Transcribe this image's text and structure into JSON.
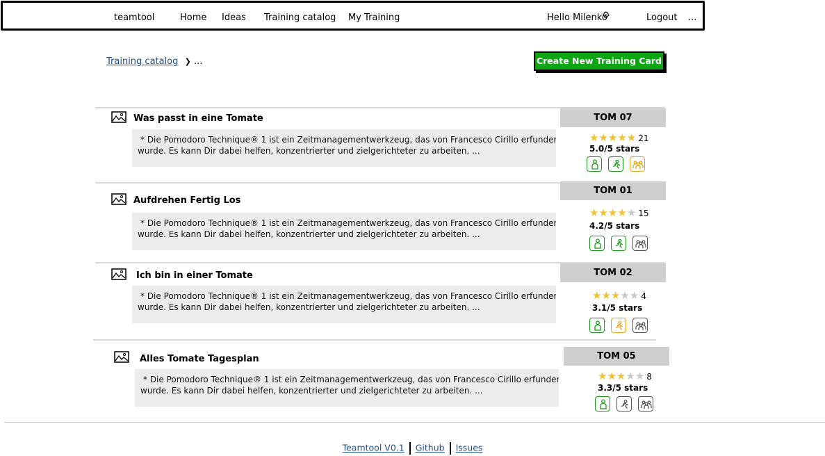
{
  "nav": {
    "brand": "teamtool",
    "items": [
      "Home",
      "Ideas",
      "Training catalog",
      "My Training"
    ],
    "greeting": "Hello Milenko",
    "logout": "Logout",
    "more": "..."
  },
  "breadcrumb": {
    "link": "Training catalog",
    "separator": "❯",
    "current": "..."
  },
  "create_button": "Create New Training Card",
  "cards": [
    {
      "title": "Was passt in eine Tomate",
      "description_line1": "* Die Pomodoro Technique® 1  ist ein Zeitmanagementwerkzeug, das von Francesco Cirillo erfunden",
      "description_line2": "wurde. Es kann Dir dabei helfen, konzentrierter und zielgerichteter zu arbeiten. ...",
      "code": "TOM 07",
      "stars_filled": 5,
      "stars_total": 5,
      "review_count": "21",
      "rating_text": "5.0/5 stars",
      "badges": [
        "active",
        "active",
        "highlight"
      ]
    },
    {
      "title": "Aufdrehen Fertig Los",
      "description_line1": "* Die Pomodoro Technique® 1  ist ein Zeitmanagementwerkzeug, das von Francesco Cirillo erfunden",
      "description_line2": "wurde. Es kann Dir dabei helfen, konzentrierter und zielgerichteter zu arbeiten. ...",
      "code": "TOM 01",
      "stars_filled": 4,
      "stars_total": 5,
      "review_count": "15",
      "rating_text": "4.2/5 stars",
      "badges": [
        "active",
        "active",
        "inactive"
      ]
    },
    {
      "title": "Ich bin in einer Tomate",
      "description_line1": "* Die Pomodoro Technique® 1  ist ein Zeitmanagementwerkzeug, das von Francesco Cirillo erfunden",
      "description_line2": "wurde. Es kann Dir dabei helfen, konzentrierter und zielgerichteter zu arbeiten. ...",
      "code": "TOM 02",
      "stars_filled": 3,
      "stars_total": 5,
      "review_count": "4",
      "rating_text": "3.1/5 stars",
      "badges": [
        "active",
        "highlight",
        "inactive"
      ]
    },
    {
      "title": "Alles Tomate Tagesplan",
      "description_line1": "* Die Pomodoro Technique® 1  ist ein Zeitmanagementwerkzeug, das von Francesco Cirillo erfunden",
      "description_line2": "wurde. Es kann Dir dabei helfen, konzentrierter und zielgerichteter zu arbeiten. ...",
      "code": "TOM 05",
      "stars_filled": 3,
      "stars_total": 5,
      "review_count": "8",
      "rating_text": "3.3/5 stars",
      "badges": [
        "active",
        "inactive",
        "inactive"
      ]
    }
  ],
  "badge_colors": {
    "active": "#1a9a1a",
    "highlight": "#e6a21a",
    "inactive": "#555555"
  },
  "icons": {
    "card_image": "image-icon",
    "user": "gear-icon"
  },
  "footer": {
    "links": [
      "Teamtool V0.1",
      "Github",
      "Issues"
    ]
  }
}
